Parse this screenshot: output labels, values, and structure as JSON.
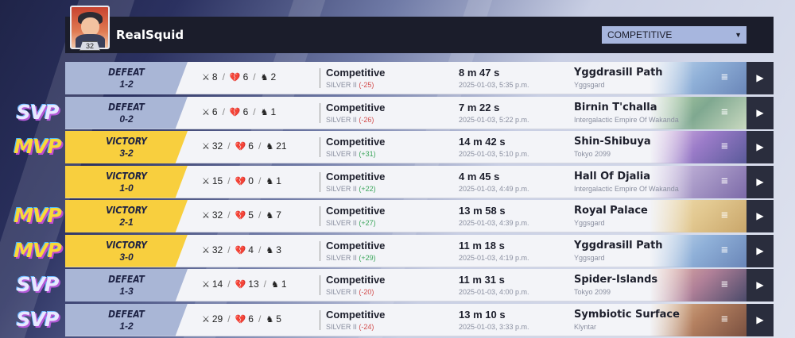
{
  "player": {
    "name": "RealSquid",
    "level": "32"
  },
  "filter": {
    "selected": "COMPETITIVE"
  },
  "colors": {
    "defeat": "#a9b6d6",
    "victory": "#f8cf3e",
    "header": "#1b1d2b",
    "negative": "#d24b4b",
    "positive": "#3aa55a"
  },
  "matches": [
    {
      "result": "DEFEAT",
      "score": "1-2",
      "kills": "8",
      "deaths": "6",
      "assists": "2",
      "mode": "Competitive",
      "rank": "SILVER II",
      "delta": "(-25)",
      "duration": "8 m 47 s",
      "date": "2025-01-03, 5:35 p.m.",
      "map": "Yggdrasill Path",
      "region": "Yggsgard",
      "badge": ""
    },
    {
      "result": "DEFEAT",
      "score": "0-2",
      "kills": "6",
      "deaths": "6",
      "assists": "1",
      "mode": "Competitive",
      "rank": "SILVER II",
      "delta": "(-26)",
      "duration": "7 m 22 s",
      "date": "2025-01-03, 5:22 p.m.",
      "map": "Birnin T'challa",
      "region": "Intergalactic Empire Of Wakanda",
      "badge": "SVP"
    },
    {
      "result": "VICTORY",
      "score": "3-2",
      "kills": "32",
      "deaths": "6",
      "assists": "21",
      "mode": "Competitive",
      "rank": "SILVER II",
      "delta": "(+31)",
      "duration": "14 m 42 s",
      "date": "2025-01-03, 5:10 p.m.",
      "map": "Shin-Shibuya",
      "region": "Tokyo 2099",
      "badge": "MVP"
    },
    {
      "result": "VICTORY",
      "score": "1-0",
      "kills": "15",
      "deaths": "0",
      "assists": "1",
      "mode": "Competitive",
      "rank": "SILVER II",
      "delta": "(+22)",
      "duration": "4 m 45 s",
      "date": "2025-01-03, 4:49 p.m.",
      "map": "Hall Of Djalia",
      "region": "Intergalactic Empire Of Wakanda",
      "badge": ""
    },
    {
      "result": "VICTORY",
      "score": "2-1",
      "kills": "32",
      "deaths": "5",
      "assists": "7",
      "mode": "Competitive",
      "rank": "SILVER II",
      "delta": "(+27)",
      "duration": "13 m 58 s",
      "date": "2025-01-03, 4:39 p.m.",
      "map": "Royal Palace",
      "region": "Yggsgard",
      "badge": "MVP"
    },
    {
      "result": "VICTORY",
      "score": "3-0",
      "kills": "32",
      "deaths": "4",
      "assists": "3",
      "mode": "Competitive",
      "rank": "SILVER II",
      "delta": "(+29)",
      "duration": "11 m 18 s",
      "date": "2025-01-03, 4:19 p.m.",
      "map": "Yggdrasill Path",
      "region": "Yggsgard",
      "badge": "MVP"
    },
    {
      "result": "DEFEAT",
      "score": "1-3",
      "kills": "14",
      "deaths": "13",
      "assists": "1",
      "mode": "Competitive",
      "rank": "SILVER II",
      "delta": "(-20)",
      "duration": "11 m 31 s",
      "date": "2025-01-03, 4:00 p.m.",
      "map": "Spider-Islands",
      "region": "Tokyo 2099",
      "badge": "SVP"
    },
    {
      "result": "DEFEAT",
      "score": "1-2",
      "kills": "29",
      "deaths": "6",
      "assists": "5",
      "mode": "Competitive",
      "rank": "SILVER II",
      "delta": "(-24)",
      "duration": "13 m 10 s",
      "date": "2025-01-03, 3:33 p.m.",
      "map": "Symbiotic Surface",
      "region": "Klyntar",
      "badge": "SVP"
    }
  ]
}
